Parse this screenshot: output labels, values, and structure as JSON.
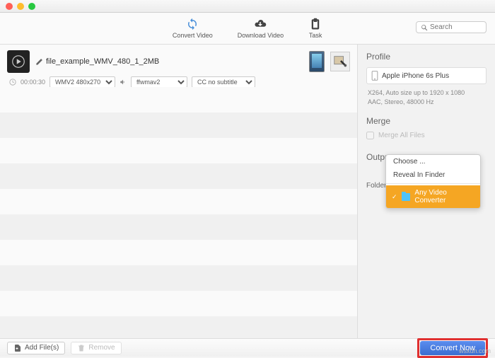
{
  "toolbar": {
    "convert_video": "Convert Video",
    "download_video": "Download Video",
    "task": "Task",
    "search_placeholder": "Search"
  },
  "file": {
    "name": "file_example_WMV_480_1_2MB",
    "duration": "00:00:30",
    "format_select": "WMV2 480x270",
    "audio_select": "ffwmav2",
    "cc_select": "CC no subtitle"
  },
  "sidebar": {
    "profile_title": "Profile",
    "profile_device": "Apple iPhone 6s Plus",
    "profile_line1": "X264, Auto size up to 1920 x 1080",
    "profile_line2": "AAC, Stereo, 48000 Hz",
    "merge_title": "Merge",
    "merge_label": "Merge All Files",
    "output_title": "Output",
    "folder_label": "Folder"
  },
  "context_menu": {
    "choose": "Choose ...",
    "reveal": "Reveal In Finder",
    "selected": "Any Video Converter"
  },
  "bottombar": {
    "add_files": "Add File(s)",
    "remove": "Remove",
    "convert_now": "Convert Now"
  },
  "watermark": "wsxdn.com"
}
